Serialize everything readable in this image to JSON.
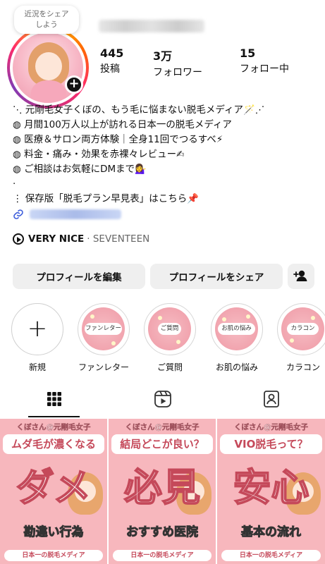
{
  "profile": {
    "note_text": "近況をシェア\nしよう",
    "stats": {
      "posts": {
        "value": "445",
        "label": "投稿"
      },
      "followers": {
        "value": "3万",
        "label": "フォロワー"
      },
      "following": {
        "value": "15",
        "label": "フォロー中"
      }
    }
  },
  "bio": {
    "lines": [
      "⋱ 元剛毛女子くぼの、もう毛に悩まない脱毛メディア🪄⋰",
      "◍ 月間100万人以上が訪れる日本一の脱毛メディア",
      "◍ 医療＆サロン両方体験｜全身11回でつるすべ⚡",
      "◍ 料金・痛み・効果を赤裸々レビュー✍",
      "◍ ご相談はお気軽にDMまで💁‍♀️",
      "·",
      "⋮ 保存版「脱毛プラン早見表」はこちら📌"
    ]
  },
  "music": {
    "song": "VERY NICE",
    "artist": "· SEVENTEEN"
  },
  "buttons": {
    "edit": "プロフィールを編集",
    "share": "プロフィールをシェア"
  },
  "highlights": [
    {
      "cover": "",
      "label": "新規"
    },
    {
      "cover": "ファンレター",
      "label": "ファンレター"
    },
    {
      "cover": "ご質問",
      "label": "ご質問"
    },
    {
      "cover": "お肌の悩み",
      "label": "お肌の悩み"
    },
    {
      "cover": "カラコン",
      "label": "カラコン"
    }
  ],
  "tabs": [
    {
      "icon": "grid-icon",
      "active": true
    },
    {
      "icon": "reels-icon",
      "active": false
    },
    {
      "icon": "tagged-icon",
      "active": false
    }
  ],
  "posts": [
    {
      "header": "くぼさん@元剛毛女子",
      "question": "ムダ毛が濃くなる",
      "big": "ダメ",
      "sub": "勘違い行為",
      "footer": "日本一の脱毛メディア"
    },
    {
      "header": "くぼさん@元剛毛女子",
      "question": "結局どこが良い？",
      "big": "必見",
      "sub": "おすすめ医院",
      "footer": "日本一の脱毛メディア"
    },
    {
      "header": "くぼさん@元剛毛女子",
      "question": "VIO脱毛って？",
      "big": "安心",
      "sub": "基本の流れ",
      "footer": "日本一の脱毛メディア"
    }
  ],
  "colors": {
    "accent": "#c5495a",
    "post_bg": "#f7b7bd",
    "button_bg": "#efefef"
  }
}
